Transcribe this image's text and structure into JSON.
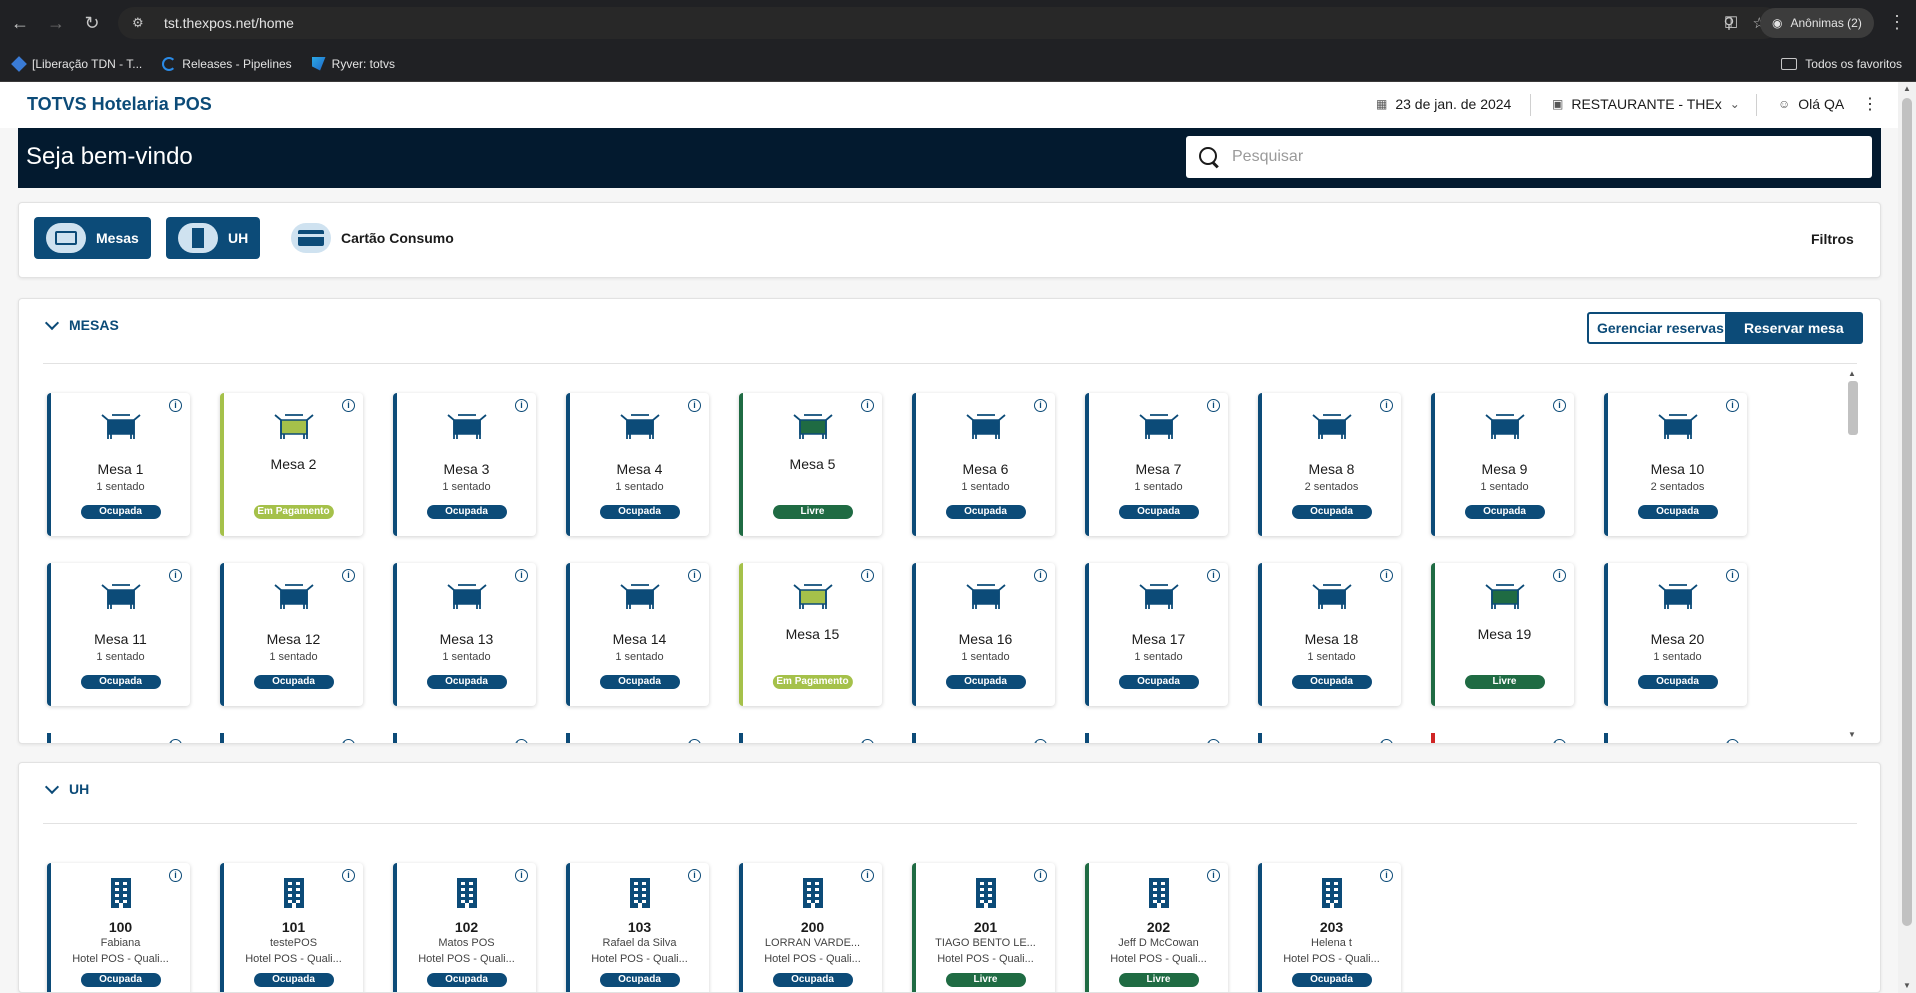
{
  "browser": {
    "url": "tst.thexpos.net/home",
    "incognito_label": "Anônimas (2)",
    "bookmarks": [
      {
        "label": "[Liberação TDN - T...",
        "icon": "diamond-icon"
      },
      {
        "label": "Releases - Pipelines",
        "icon": "pipelines-icon"
      },
      {
        "label": "Ryver: totvs",
        "icon": "ryver-icon"
      }
    ],
    "all_bookmarks_label": "Todos os favoritos"
  },
  "header": {
    "app_title": "TOTVS Hotelaria POS",
    "date": "23 de jan. de 2024",
    "unit": "RESTAURANTE - THEx",
    "user": "Olá QA"
  },
  "welcome": {
    "title": "Seja bem-vindo",
    "search_placeholder": "Pesquisar"
  },
  "filters": {
    "mesas_label": "Mesas",
    "uh_label": "UH",
    "cartao_label": "Cartão Consumo",
    "filtros_label": "Filtros"
  },
  "mesas_section": {
    "title": "MESAS",
    "manage_label": "Gerenciar reservas",
    "reserve_label": "Reservar mesa",
    "tables": [
      {
        "name": "Mesa 1",
        "seated": "1 sentado",
        "status": "Ocupada",
        "kind": "occ"
      },
      {
        "name": "Mesa 2",
        "seated": "",
        "status": "Em Pagamento",
        "kind": "pay"
      },
      {
        "name": "Mesa 3",
        "seated": "1 sentado",
        "status": "Ocupada",
        "kind": "occ"
      },
      {
        "name": "Mesa 4",
        "seated": "1 sentado",
        "status": "Ocupada",
        "kind": "occ"
      },
      {
        "name": "Mesa 5",
        "seated": "",
        "status": "Livre",
        "kind": "free"
      },
      {
        "name": "Mesa 6",
        "seated": "1 sentado",
        "status": "Ocupada",
        "kind": "occ"
      },
      {
        "name": "Mesa 7",
        "seated": "1 sentado",
        "status": "Ocupada",
        "kind": "occ"
      },
      {
        "name": "Mesa 8",
        "seated": "2 sentados",
        "status": "Ocupada",
        "kind": "occ"
      },
      {
        "name": "Mesa 9",
        "seated": "1 sentado",
        "status": "Ocupada",
        "kind": "occ"
      },
      {
        "name": "Mesa 10",
        "seated": "2 sentados",
        "status": "Ocupada",
        "kind": "occ"
      },
      {
        "name": "Mesa 11",
        "seated": "1 sentado",
        "status": "Ocupada",
        "kind": "occ"
      },
      {
        "name": "Mesa 12",
        "seated": "1 sentado",
        "status": "Ocupada",
        "kind": "occ"
      },
      {
        "name": "Mesa 13",
        "seated": "1 sentado",
        "status": "Ocupada",
        "kind": "occ"
      },
      {
        "name": "Mesa 14",
        "seated": "1 sentado",
        "status": "Ocupada",
        "kind": "occ"
      },
      {
        "name": "Mesa 15",
        "seated": "",
        "status": "Em Pagamento",
        "kind": "pay"
      },
      {
        "name": "Mesa 16",
        "seated": "1 sentado",
        "status": "Ocupada",
        "kind": "occ"
      },
      {
        "name": "Mesa 17",
        "seated": "1 sentado",
        "status": "Ocupada",
        "kind": "occ"
      },
      {
        "name": "Mesa 18",
        "seated": "1 sentado",
        "status": "Ocupada",
        "kind": "occ"
      },
      {
        "name": "Mesa 19",
        "seated": "",
        "status": "Livre",
        "kind": "free"
      },
      {
        "name": "Mesa 20",
        "seated": "1 sentado",
        "status": "Ocupada",
        "kind": "occ"
      }
    ]
  },
  "uh_section": {
    "title": "UH",
    "rooms": [
      {
        "number": "100",
        "guest": "Fabiana",
        "hotel": "Hotel POS - Quali...",
        "status": "Ocupada",
        "kind": "occ"
      },
      {
        "number": "101",
        "guest": "testePOS",
        "hotel": "Hotel POS - Quali...",
        "status": "Ocupada",
        "kind": "occ"
      },
      {
        "number": "102",
        "guest": "Matos POS",
        "hotel": "Hotel POS - Quali...",
        "status": "Ocupada",
        "kind": "occ"
      },
      {
        "number": "103",
        "guest": "Rafael da Silva",
        "hotel": "Hotel POS - Quali...",
        "status": "Ocupada",
        "kind": "occ"
      },
      {
        "number": "200",
        "guest": "LORRAN VARDE...",
        "hotel": "Hotel POS - Quali...",
        "status": "Ocupada",
        "kind": "occ"
      },
      {
        "number": "201",
        "guest": "TIAGO BENTO LE...",
        "hotel": "Hotel POS - Quali...",
        "status": "Livre",
        "kind": "free"
      },
      {
        "number": "202",
        "guest": "Jeff D McCowan",
        "hotel": "Hotel POS - Quali...",
        "status": "Livre",
        "kind": "free"
      },
      {
        "number": "203",
        "guest": "Helena t",
        "hotel": "Hotel POS - Quali...",
        "status": "Ocupada",
        "kind": "occ"
      }
    ]
  },
  "colors": {
    "primary": "#0c4b78",
    "dark_banner": "#031a2f",
    "payment": "#a5c14a",
    "free": "#1f6b43",
    "alert": "#d02626"
  }
}
